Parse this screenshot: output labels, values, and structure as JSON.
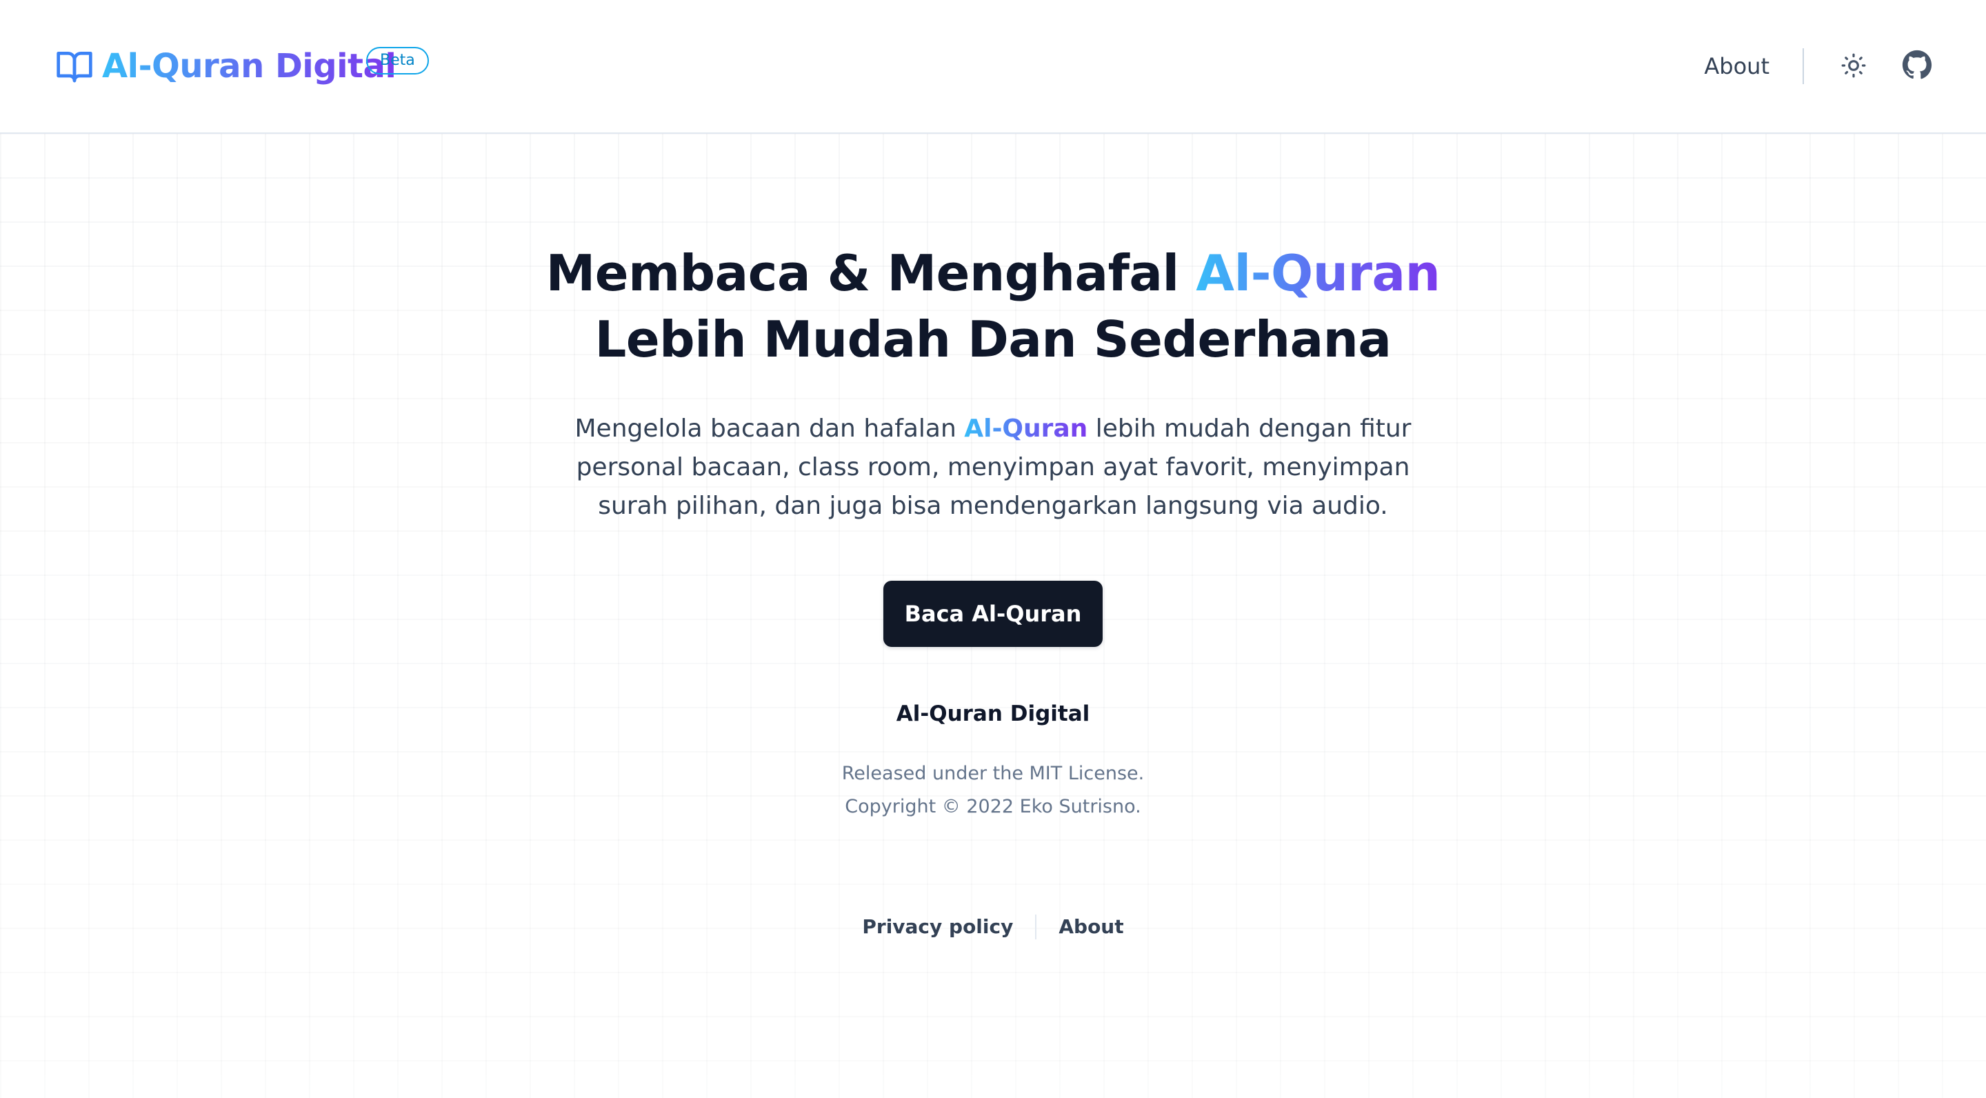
{
  "header": {
    "brand_name": "Al-Quran Digital",
    "badge": "Beta",
    "nav_about": "About",
    "icons": {
      "brand": "open-book-icon",
      "theme_toggle": "sun-icon",
      "repo": "github-icon"
    }
  },
  "hero": {
    "title_part1": "Membaca & Menghafal ",
    "title_highlight": "Al-Quran",
    "title_line2": "Lebih Mudah Dan Sederhana",
    "desc_part1": "Mengelola bacaan dan hafalan ",
    "desc_highlight": "Al-Quran",
    "desc_part2": " lebih mudah dengan fitur personal bacaan, class room, menyimpan ayat favorit, menyimpan surah pilihan, dan juga bisa mendengarkan langsung via audio.",
    "cta_label": "Baca Al-Quran"
  },
  "footer": {
    "title": "Al-Quran Digital",
    "license": "Released under the MIT License.",
    "copyright": "Copyright © 2022 Eko Sutrisno.",
    "links": [
      {
        "label": "Privacy policy"
      },
      {
        "label": "About"
      }
    ]
  },
  "colors": {
    "gradient_start": "#38bdf8",
    "gradient_mid": "#6366f1",
    "gradient_end": "#7c3aed",
    "heading": "#0f172a",
    "body_text": "#334155",
    "muted_text": "#64748b",
    "cta_background": "#111827",
    "badge_border": "#0ea5e9"
  }
}
